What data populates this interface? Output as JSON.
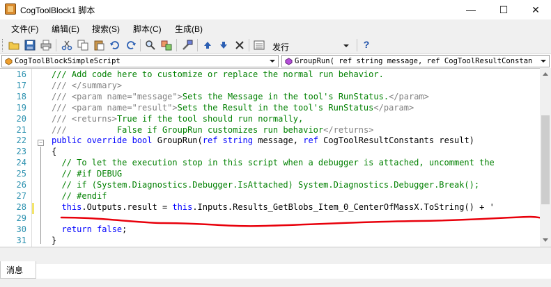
{
  "window": {
    "title": "CogToolBlock1 脚本",
    "minimize": "—",
    "maximize": "☐",
    "close": "✕"
  },
  "menu": {
    "items": [
      "文件(F)",
      "编辑(E)",
      "搜索(S)",
      "脚本(C)",
      "生成(B)"
    ]
  },
  "toolbar": {
    "icons": [
      "open-icon",
      "save-icon",
      "print-icon",
      "cut-icon",
      "copy-icon",
      "paste-icon",
      "undo-icon",
      "redo-icon",
      "find-icon",
      "replace-icon",
      "build-icon",
      "move-up-icon",
      "move-down-icon",
      "delete-icon",
      "goto-icon",
      "help-icon"
    ],
    "combo_value": "发行",
    "help_glyph": "?"
  },
  "nav": {
    "left_value": "CogToolBlockSimpleScript",
    "right_value": "GroupRun( ref string message,  ref CogToolResultConstan"
  },
  "editor": {
    "lines": [
      {
        "num": "16",
        "parts": [
          {
            "t": "/// Add code here to customize or replace the normal run behavior.",
            "c": "c-comment"
          }
        ]
      },
      {
        "num": "17",
        "parts": [
          {
            "t": "/// ",
            "c": "c-gray"
          },
          {
            "t": "</summary>",
            "c": "c-gray"
          }
        ]
      },
      {
        "num": "18",
        "parts": [
          {
            "t": "/// ",
            "c": "c-gray"
          },
          {
            "t": "<param name=\"message\">",
            "c": "c-gray"
          },
          {
            "t": "Sets the Message in the tool's RunStatus.",
            "c": "c-comment"
          },
          {
            "t": "</param>",
            "c": "c-gray"
          }
        ]
      },
      {
        "num": "19",
        "parts": [
          {
            "t": "/// ",
            "c": "c-gray"
          },
          {
            "t": "<param name=\"result\">",
            "c": "c-gray"
          },
          {
            "t": "Sets the Result in the tool's RunStatus",
            "c": "c-comment"
          },
          {
            "t": "</param>",
            "c": "c-gray"
          }
        ]
      },
      {
        "num": "20",
        "parts": [
          {
            "t": "/// ",
            "c": "c-gray"
          },
          {
            "t": "<returns>",
            "c": "c-gray"
          },
          {
            "t": "True if the tool should run normally,",
            "c": "c-comment"
          }
        ]
      },
      {
        "num": "21",
        "parts": [
          {
            "t": "///          ",
            "c": "c-gray"
          },
          {
            "t": "False if GroupRun customizes run behavior",
            "c": "c-comment"
          },
          {
            "t": "</returns>",
            "c": "c-gray"
          }
        ]
      },
      {
        "num": "22",
        "parts": [
          {
            "t": "public override bool ",
            "c": "c-kw"
          },
          {
            "t": "GroupRun(",
            "c": "c-plain"
          },
          {
            "t": "ref string ",
            "c": "c-kw"
          },
          {
            "t": "message, ",
            "c": "c-plain"
          },
          {
            "t": "ref ",
            "c": "c-kw"
          },
          {
            "t": "CogToolResultConstants result)",
            "c": "c-plain"
          }
        ]
      },
      {
        "num": "23",
        "parts": [
          {
            "t": "{",
            "c": "c-plain"
          }
        ]
      },
      {
        "num": "24",
        "parts": [
          {
            "t": "  // To let the execution stop in this script when a debugger is attached, uncomment the",
            "c": "c-comment"
          }
        ]
      },
      {
        "num": "25",
        "parts": [
          {
            "t": "  // #if DEBUG",
            "c": "c-comment"
          }
        ]
      },
      {
        "num": "26",
        "parts": [
          {
            "t": "  // if (System.Diagnostics.Debugger.IsAttached) System.Diagnostics.Debugger.Break();",
            "c": "c-comment"
          }
        ]
      },
      {
        "num": "27",
        "parts": [
          {
            "t": "  // #endif",
            "c": "c-comment"
          }
        ]
      },
      {
        "num": "28",
        "parts": [
          {
            "t": "  this",
            "c": "c-kw"
          },
          {
            "t": ".Outputs.result = ",
            "c": "c-plain"
          },
          {
            "t": "this",
            "c": "c-kw"
          },
          {
            "t": ".Inputs.Results_GetBlobs_Item_0_CenterOfMassX.ToString() + '",
            "c": "c-plain"
          }
        ]
      },
      {
        "num": "29",
        "parts": [
          {
            "t": "",
            "c": "c-plain"
          }
        ]
      },
      {
        "num": "30",
        "parts": [
          {
            "t": "  return false",
            "c": "c-kw"
          },
          {
            "t": ";",
            "c": "c-plain"
          }
        ]
      },
      {
        "num": "31",
        "parts": [
          {
            "t": "}",
            "c": "c-plain"
          }
        ]
      }
    ]
  },
  "bottom": {
    "tab_label": "消息"
  },
  "colors": {
    "line_numbers": "#2b91af",
    "comment": "#008000",
    "keyword": "#0000ff",
    "annotation": "#e8000b"
  }
}
